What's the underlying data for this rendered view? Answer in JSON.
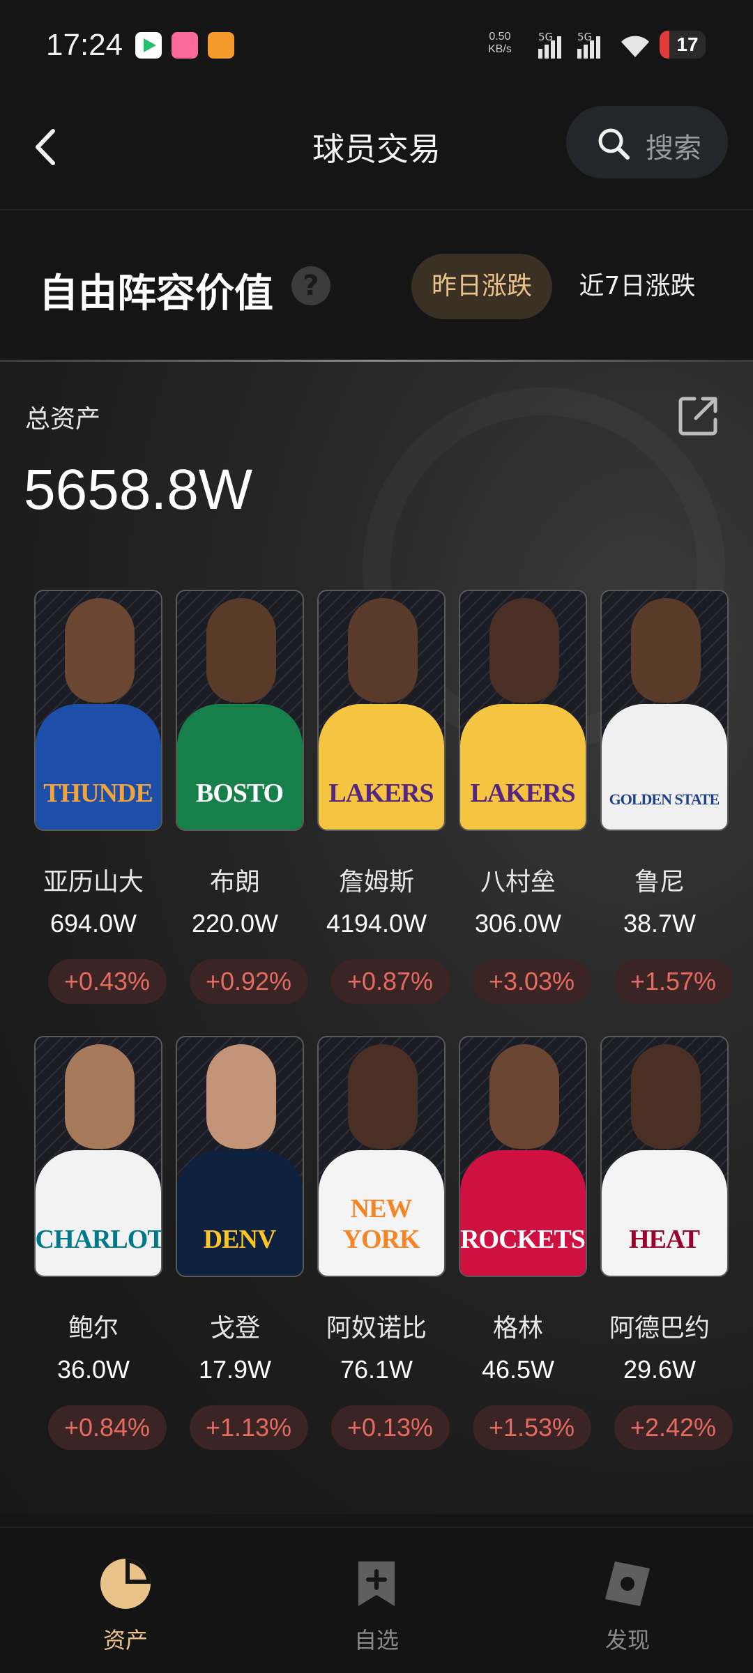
{
  "status_bar": {
    "time": "17:24",
    "net_speed_value": "0.50",
    "net_speed_unit": "KB/s",
    "signal1_label": "5G",
    "signal2_label": "5G",
    "battery": "17"
  },
  "header": {
    "title": "球员交易",
    "search_label": "搜索"
  },
  "section": {
    "title": "自由阵容价值",
    "help": "?",
    "tabs": [
      {
        "label": "昨日涨跌",
        "active": true
      },
      {
        "label": "近7日涨跌",
        "active": false
      }
    ]
  },
  "assets": {
    "label": "总资产",
    "value": "5658.8W"
  },
  "players": [
    {
      "name": "亚历山大",
      "value": "694.0W",
      "change": "+0.43%",
      "jersey": "THUNDE",
      "jersey_color": "#1e4fa8",
      "jersey_text_color": "#f2a43a",
      "skin": "#6b4632"
    },
    {
      "name": "布朗",
      "value": "220.0W",
      "change": "+0.92%",
      "jersey": "BOSTO",
      "jersey_color": "#17804a",
      "jersey_text_color": "#ffffff",
      "skin": "#5a3a28"
    },
    {
      "name": "詹姆斯",
      "value": "4194.0W",
      "change": "+0.87%",
      "jersey": "LAKERS",
      "jersey_color": "#f5c542",
      "jersey_text_color": "#552583",
      "skin": "#5a3a2a"
    },
    {
      "name": "八村垒",
      "value": "306.0W",
      "change": "+3.03%",
      "jersey": "LAKERS",
      "jersey_color": "#f5c542",
      "jersey_text_color": "#552583",
      "skin": "#4a3024"
    },
    {
      "name": "鲁尼",
      "value": "38.7W",
      "change": "+1.57%",
      "jersey": "GOLDEN STATE",
      "jersey_color": "#f0f0f0",
      "jersey_text_color": "#1d428a",
      "skin": "#5a3a28"
    },
    {
      "name": "鲍尔",
      "value": "36.0W",
      "change": "+0.84%",
      "jersey": "CHARLOTT",
      "jersey_color": "#f2f2f2",
      "jersey_text_color": "#00788c",
      "skin": "#a87a5c"
    },
    {
      "name": "戈登",
      "value": "17.9W",
      "change": "+1.13%",
      "jersey": "DENV",
      "jersey_color": "#0e2240",
      "jersey_text_color": "#fec524",
      "skin": "#c49478"
    },
    {
      "name": "阿奴诺比",
      "value": "76.1W",
      "change": "+0.13%",
      "jersey": "NEW YORK",
      "jersey_color": "#f4f4f4",
      "jersey_text_color": "#f58426",
      "skin": "#4a3024"
    },
    {
      "name": "格林",
      "value": "46.5W",
      "change": "+1.53%",
      "jersey": "ROCKETS",
      "jersey_color": "#ce1141",
      "jersey_text_color": "#ffffff",
      "skin": "#6b4632"
    },
    {
      "name": "阿德巴约",
      "value": "29.6W",
      "change": "+2.42%",
      "jersey": "HEAT",
      "jersey_color": "#f4f4f4",
      "jersey_text_color": "#98002e",
      "skin": "#4a3024"
    }
  ],
  "bottom_nav": {
    "assets": "资产",
    "watchlist": "自选",
    "discover": "发现"
  },
  "colors": {
    "accent": "#e9c38a",
    "positive_change": "#e46b62",
    "background": "#151515"
  }
}
